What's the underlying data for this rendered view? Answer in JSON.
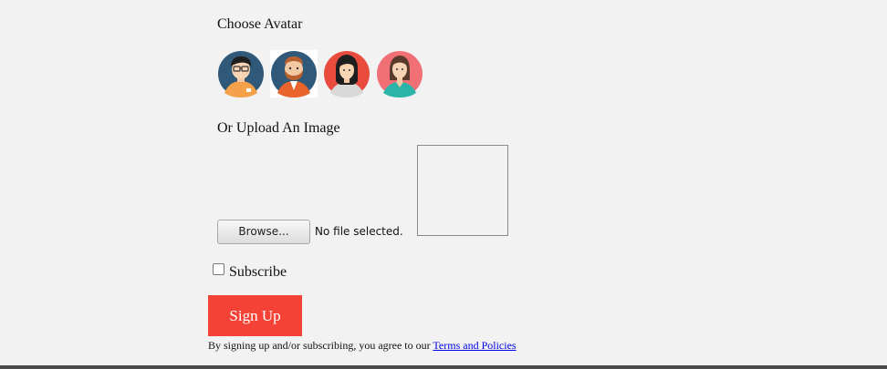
{
  "avatar_section": {
    "title": "Choose Avatar",
    "avatars": [
      {
        "icon": "man-glasses-avatar-icon",
        "bg": "#2f5879"
      },
      {
        "icon": "bearded-man-avatar-icon",
        "bg": "#2f5879",
        "selected": true
      },
      {
        "icon": "woman-dark-hair-avatar-icon",
        "bg": "#e94b3c"
      },
      {
        "icon": "woman-brown-hair-avatar-icon",
        "bg": "#f07075"
      }
    ]
  },
  "upload_section": {
    "title": "Or Upload An Image",
    "browse_label": "Browse...",
    "file_status": "No file selected."
  },
  "subscribe": {
    "label": "Subscribe",
    "checked": false
  },
  "signup_button": {
    "label": "Sign Up",
    "color": "#f44336"
  },
  "legal": {
    "text": "By signing up and/or subscribing, you agree to our ",
    "link_text": "Terms and Policies"
  }
}
